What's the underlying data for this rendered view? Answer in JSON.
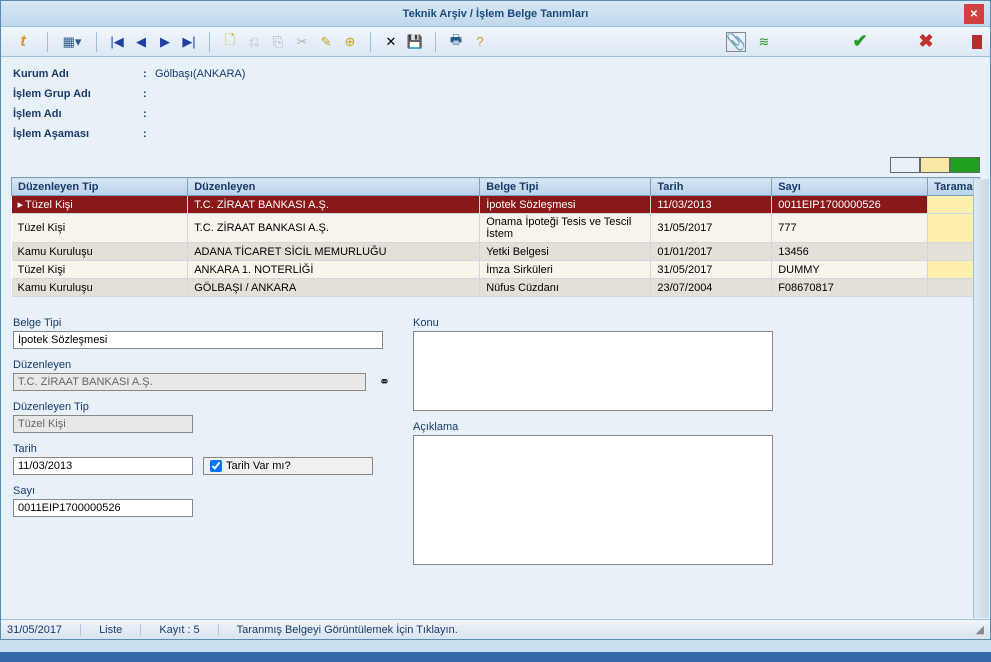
{
  "window": {
    "title": "Teknik Arşiv / İşlem Belge Tanımları"
  },
  "info": {
    "kurum_label": "Kurum Adı",
    "kurum_val": "Gölbaşı(ANKARA)",
    "grup_label": "İşlem Grup Adı",
    "grup_val": "",
    "islem_label": "İşlem Adı",
    "islem_val": "",
    "asama_label": "İşlem Aşaması",
    "asama_val": "",
    "colon": ":"
  },
  "grid": {
    "headers": {
      "tip": "Düzenleyen Tip",
      "duz": "Düzenleyen",
      "belge": "Belge Tipi",
      "tarih": "Tarih",
      "sayi": "Sayı",
      "tarama": "Tarama"
    },
    "rows": [
      {
        "tip": "Tüzel Kişi",
        "duz": "T.C. ZİRAAT BANKASI A.Ş.",
        "belge": "İpotek Sözleşmesi",
        "tarih": "11/03/2013",
        "sayi": "0011EIP1700000526",
        "selected": true
      },
      {
        "tip": "Tüzel Kişi",
        "duz": "T.C. ZİRAAT BANKASI A.Ş.",
        "belge": "Onama İpoteği Tesis ve Tescil İstem",
        "tarih": "31/05/2017",
        "sayi": "777"
      },
      {
        "tip": "Kamu Kuruluşu",
        "duz": "ADANA TİCARET SİCİL MEMURLUĞU",
        "belge": "Yetki Belgesi",
        "tarih": "01/01/2017",
        "sayi": "13456",
        "alt": true
      },
      {
        "tip": "Tüzel Kişi",
        "duz": "ANKARA 1. NOTERLİĞİ",
        "belge": "İmza Sirküleri",
        "tarih": "31/05/2017",
        "sayi": "DUMMY"
      },
      {
        "tip": "Kamu Kuruluşu",
        "duz": "GÖLBAŞI / ANKARA",
        "belge": "Nüfus Cüzdanı",
        "tarih": "23/07/2004",
        "sayi": "F08670817",
        "alt": true
      }
    ]
  },
  "form": {
    "belge_tipi_label": "Belge Tipi",
    "belge_tipi": "İpotek Sözleşmesi",
    "duzenleyen_label": "Düzenleyen",
    "duzenleyen": "T.C. ZİRAAT BANKASI A.Ş.",
    "duzenleyen_tip_label": "Düzenleyen Tip",
    "duzenleyen_tip": "Tüzel Kişi",
    "tarih_label": "Tarih",
    "tarih": "11/03/2013",
    "tarih_var_label": "Tarih Var mı?",
    "sayi_label": "Sayı",
    "sayi": "0011EIP1700000526",
    "konu_label": "Konu",
    "konu": "",
    "aciklama_label": "Açıklama",
    "aciklama": ""
  },
  "status": {
    "date": "31/05/2017",
    "mode": "Liste",
    "count_label": "Kayıt : 5",
    "hint": "Taranmış Belgeyi Görüntülemek İçin Tıklayın."
  },
  "colors": {
    "c1": "#ffffff",
    "c2": "#f8e8a8",
    "c3": "#20a020"
  }
}
